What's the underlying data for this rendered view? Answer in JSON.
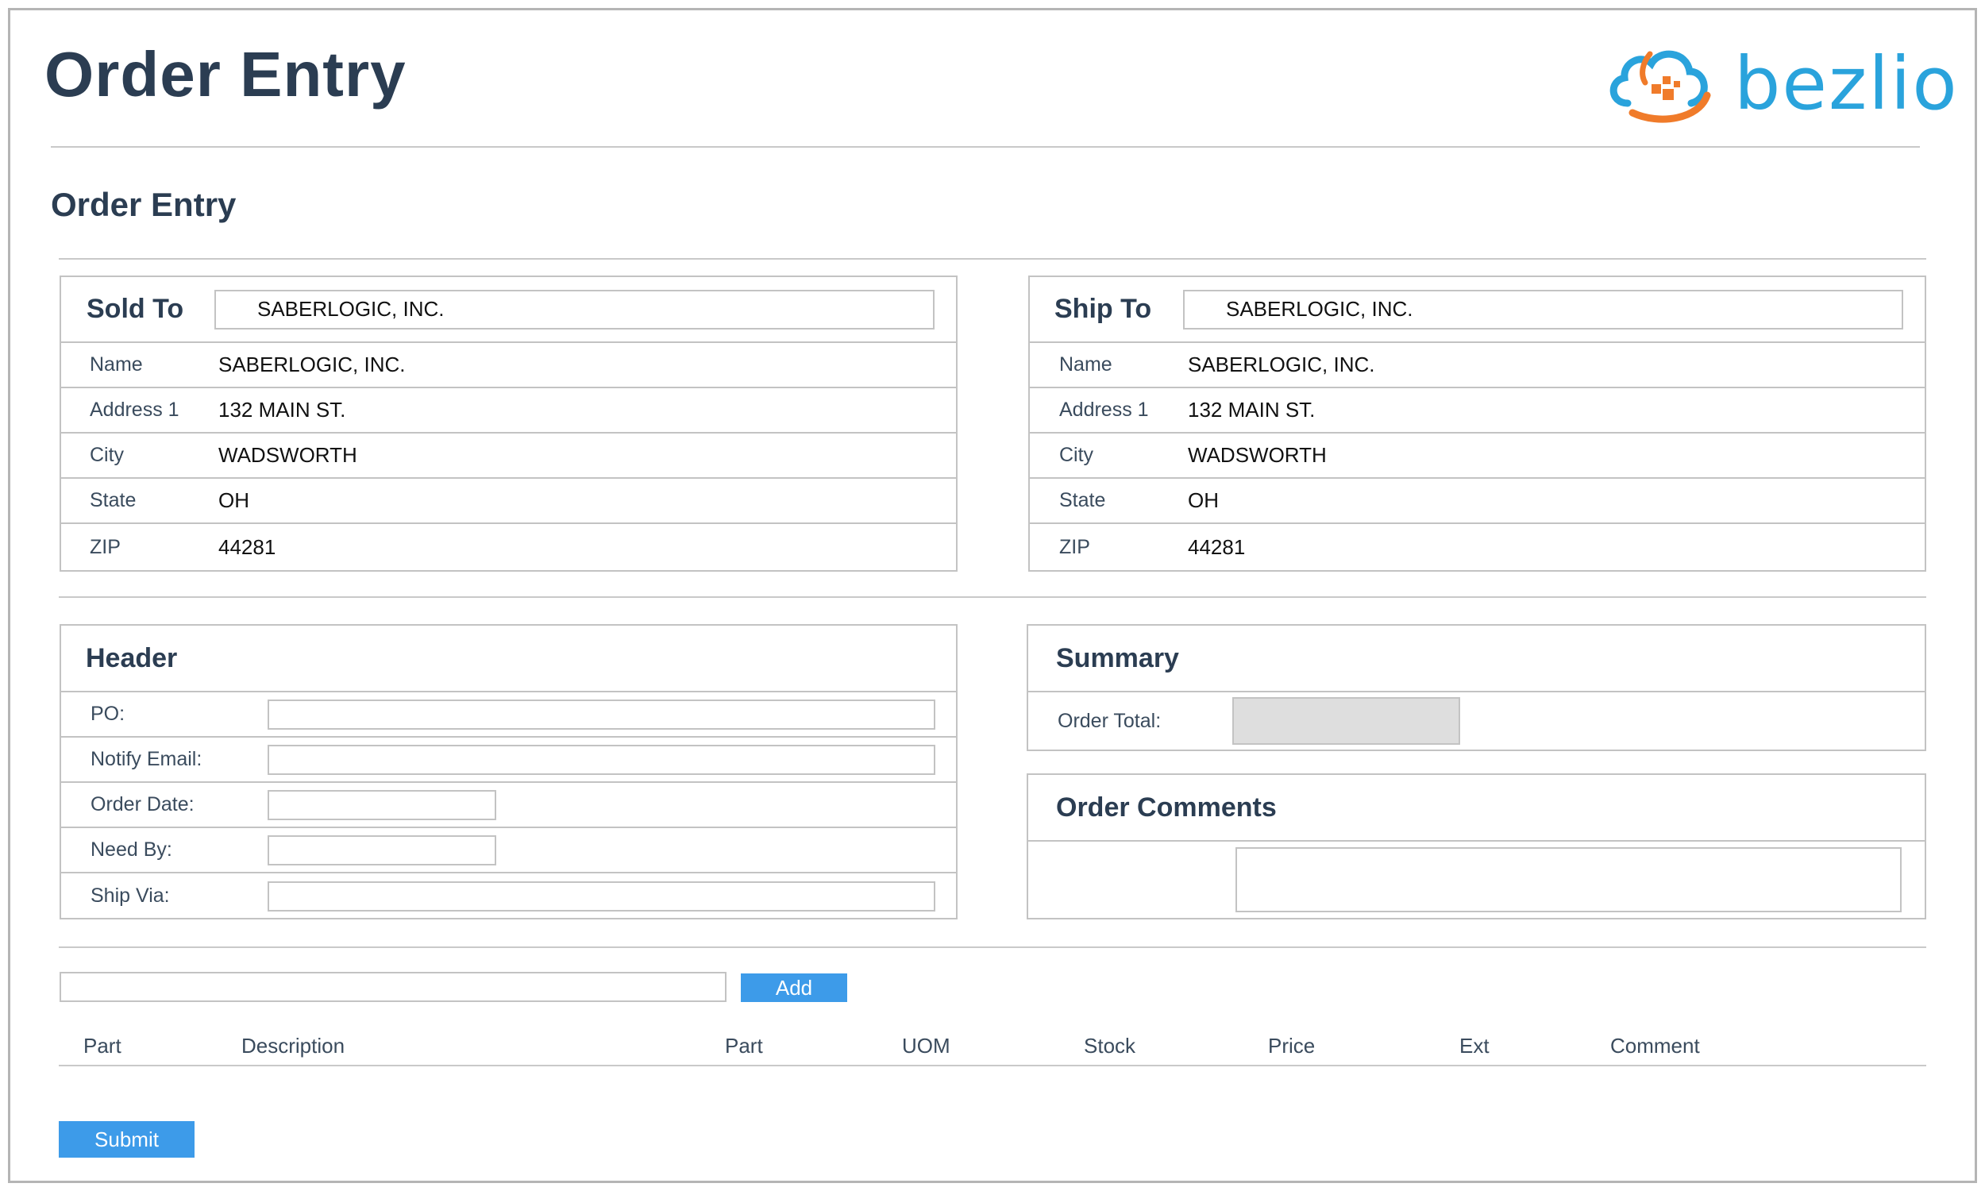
{
  "app": {
    "title": "Order Entry"
  },
  "logo": {
    "text": "bezlio",
    "primary_color": "#2aa3dc",
    "accent_color": "#f07b2a"
  },
  "page": {
    "title": "Order Entry"
  },
  "sold_to": {
    "title": "Sold To",
    "selected": "SABERLOGIC, INC.",
    "fields": [
      {
        "label": "Name",
        "value": "SABERLOGIC, INC."
      },
      {
        "label": "Address 1",
        "value": "132 MAIN ST."
      },
      {
        "label": "City",
        "value": "WADSWORTH"
      },
      {
        "label": "State",
        "value": "OH"
      },
      {
        "label": "ZIP",
        "value": "44281"
      }
    ]
  },
  "ship_to": {
    "title": "Ship To",
    "selected": "SABERLOGIC, INC.",
    "fields": [
      {
        "label": "Name",
        "value": "SABERLOGIC, INC."
      },
      {
        "label": "Address 1",
        "value": "132 MAIN ST."
      },
      {
        "label": "City",
        "value": "WADSWORTH"
      },
      {
        "label": "State",
        "value": "OH"
      },
      {
        "label": "ZIP",
        "value": "44281"
      }
    ]
  },
  "header": {
    "title": "Header",
    "fields": [
      {
        "label": "PO:",
        "value": ""
      },
      {
        "label": "Notify Email:",
        "value": ""
      },
      {
        "label": "Order Date:",
        "value": ""
      },
      {
        "label": "Need By:",
        "value": ""
      },
      {
        "label": "Ship Via:",
        "value": ""
      }
    ]
  },
  "summary": {
    "title": "Summary",
    "order_total_label": "Order Total:",
    "order_total_value": ""
  },
  "comments": {
    "title": "Order Comments",
    "value": ""
  },
  "lines": {
    "part_input_value": "",
    "add_label": "Add",
    "columns": [
      "Part",
      "Description",
      "Part",
      "UOM",
      "Stock",
      "Price",
      "Ext",
      "Comment"
    ]
  },
  "submit_label": "Submit",
  "colors": {
    "heading": "#2b3d52",
    "button": "#3d9be9",
    "border": "#c3c3c3",
    "readonly_fill": "#dedede"
  }
}
